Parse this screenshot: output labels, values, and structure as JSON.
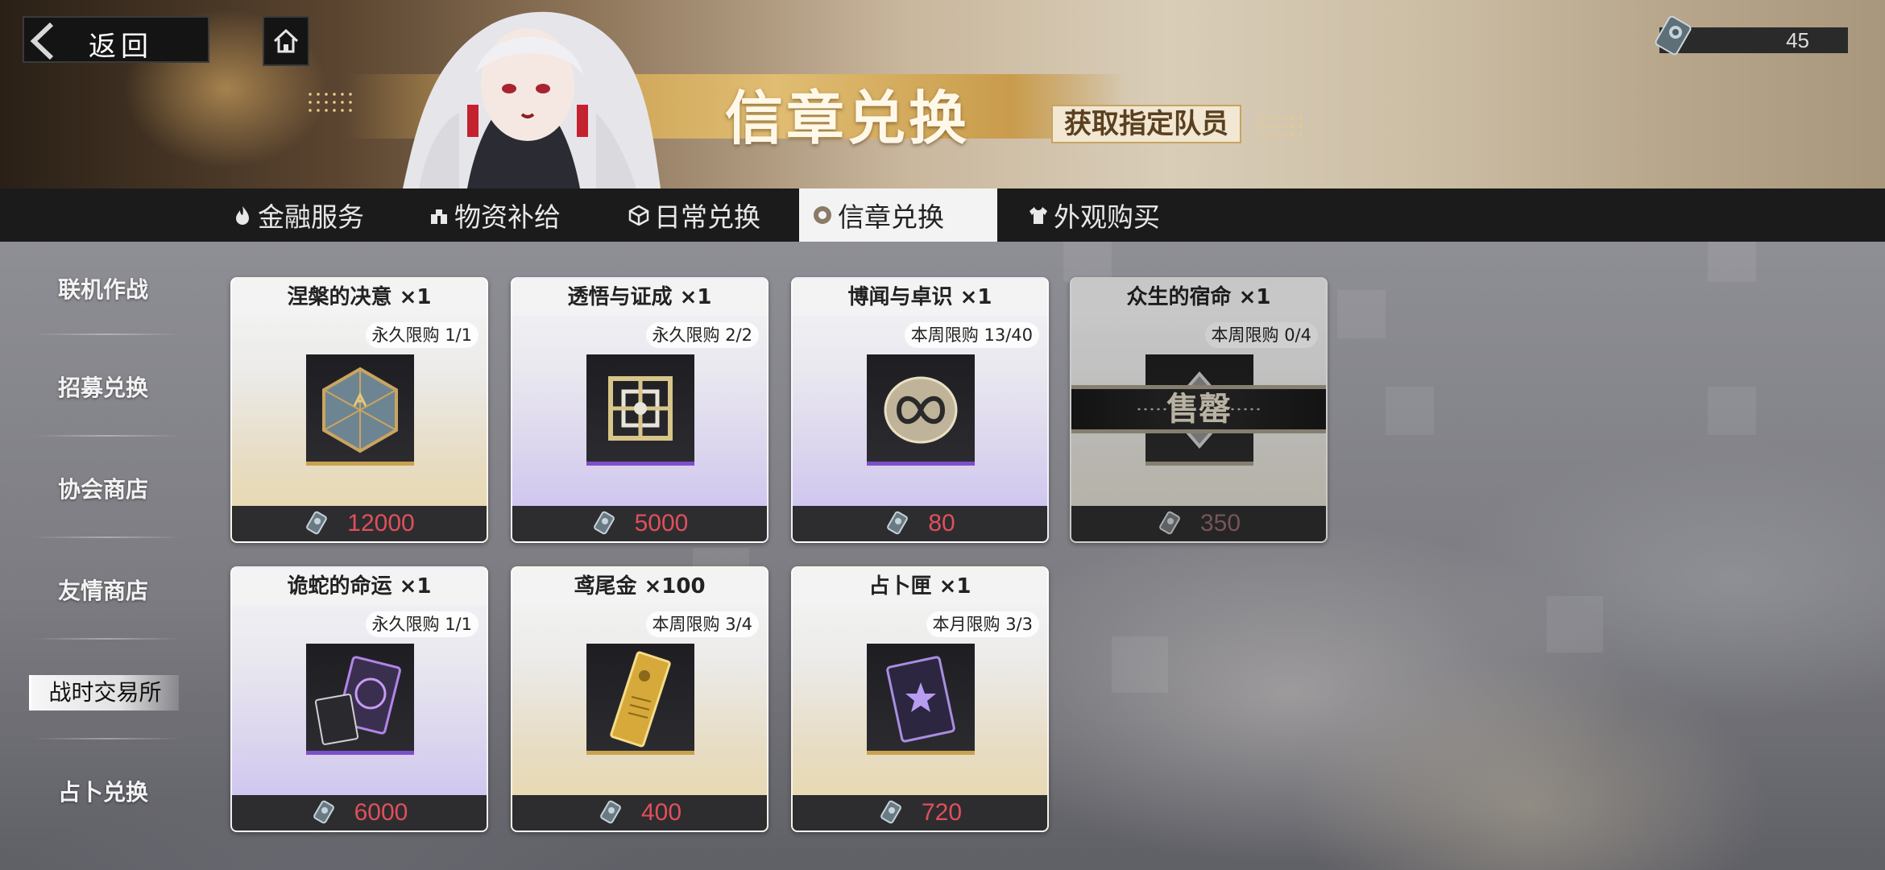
{
  "header": {
    "back_label": "返回",
    "title": "信章兑换",
    "subtitle": "获取指定队员"
  },
  "currency": {
    "amount": "45",
    "icon": "badge-token-icon"
  },
  "tabs": [
    {
      "label": "金融服务",
      "icon": "flame-icon",
      "active": false
    },
    {
      "label": "物资补给",
      "icon": "supply-icon",
      "active": false
    },
    {
      "label": "日常兑换",
      "icon": "cube-icon",
      "active": false
    },
    {
      "label": "信章兑换",
      "icon": "badge-icon",
      "active": true
    },
    {
      "label": "外观购买",
      "icon": "shirt-icon",
      "active": false
    }
  ],
  "sidebar": {
    "items": [
      {
        "label": "联机作战"
      },
      {
        "label": "招募兑换"
      },
      {
        "label": "协会商店"
      },
      {
        "label": "友情商店"
      },
      {
        "label": "战时交易所",
        "active": true
      },
      {
        "label": "占卜兑换"
      }
    ]
  },
  "cards": [
    {
      "name": "涅槃的决意 ×1",
      "limit": "永久限购 1/1",
      "price": "12000",
      "theme": "gold",
      "sold_out": false
    },
    {
      "name": "透悟与证成 ×1",
      "limit": "永久限购 2/2",
      "price": "5000",
      "theme": "purple",
      "sold_out": false
    },
    {
      "name": "博闻与卓识 ×1",
      "limit": "本周限购 13/40",
      "price": "80",
      "theme": "purple",
      "sold_out": false
    },
    {
      "name": "众生的宿命 ×1",
      "limit": "本周限购 0/4",
      "price": "350",
      "theme": "gold",
      "sold_out": true,
      "sold_out_label": "售罄"
    },
    {
      "name": "诡蛇的命运 ×1",
      "limit": "永久限购 1/1",
      "price": "6000",
      "theme": "purple",
      "sold_out": false
    },
    {
      "name": "鸢尾金 ×100",
      "limit": "本周限购 3/4",
      "price": "400",
      "theme": "gold",
      "sold_out": false
    },
    {
      "name": "占卜匣 ×1",
      "limit": "本月限购 3/3",
      "price": "720",
      "theme": "gold",
      "sold_out": false
    }
  ]
}
